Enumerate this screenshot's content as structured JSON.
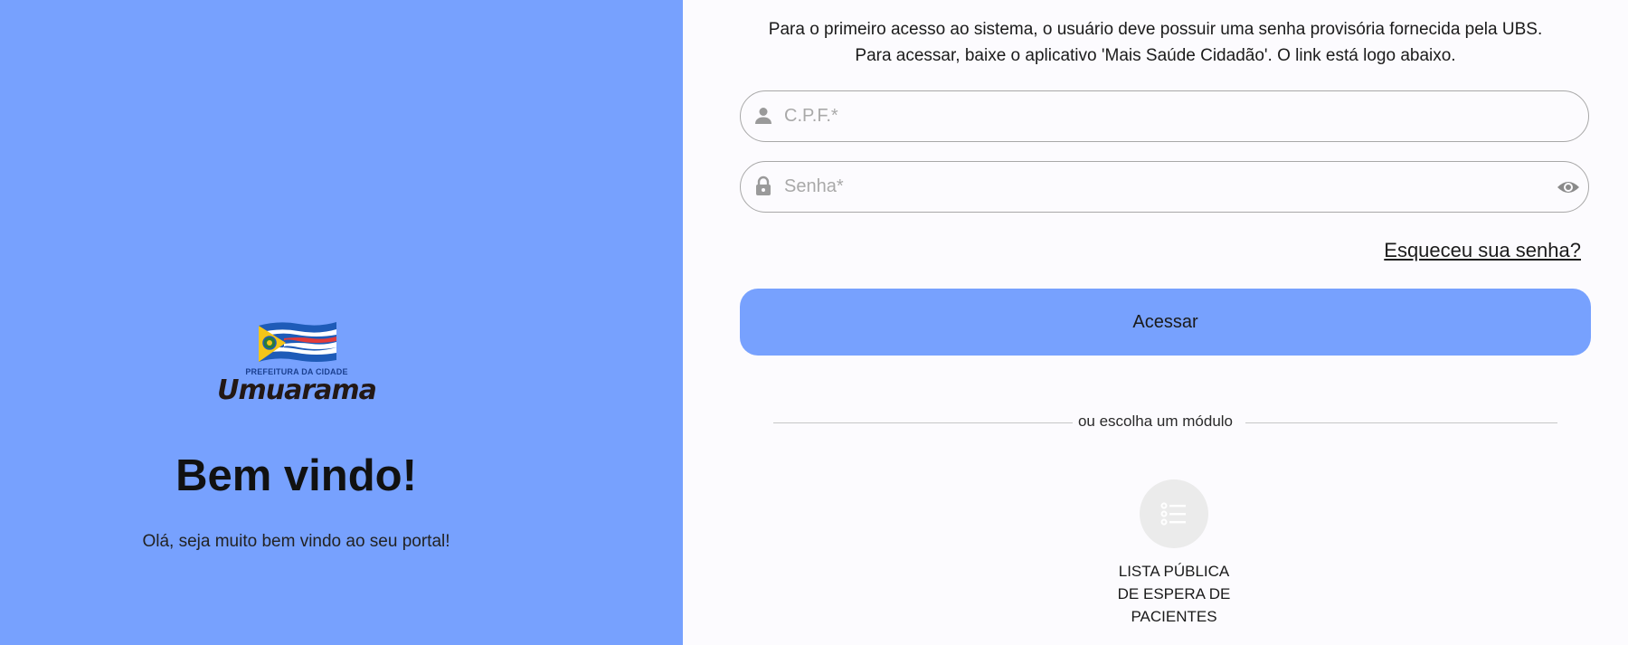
{
  "branding": {
    "logo_subtitle": "PREFEITURA DA CIDADE",
    "logo_name": "Umuarama",
    "primary_color": "#77a1fe"
  },
  "welcome": {
    "title": "Bem vindo!",
    "subtitle": "Olá, seja muito bem vindo ao seu portal!"
  },
  "login": {
    "info_line1": "Para o primeiro acesso ao sistema, o usuário deve possuir uma senha provisória fornecida pela UBS.",
    "info_line2": "Para acessar, baixe o aplicativo 'Mais Saúde Cidadão'. O link está logo abaixo.",
    "cpf_placeholder": "C.P.F.*",
    "cpf_value": "",
    "password_placeholder": "Senha*",
    "password_value": "",
    "forgot_label": "Esqueceu sua senha?",
    "submit_label": "Acessar",
    "divider_label": "ou escolha um módulo"
  },
  "modules": [
    {
      "icon": "list-icon",
      "label_lines": [
        "LISTA PÚBLICA",
        "DE ESPERA DE",
        "PACIENTES"
      ]
    }
  ]
}
